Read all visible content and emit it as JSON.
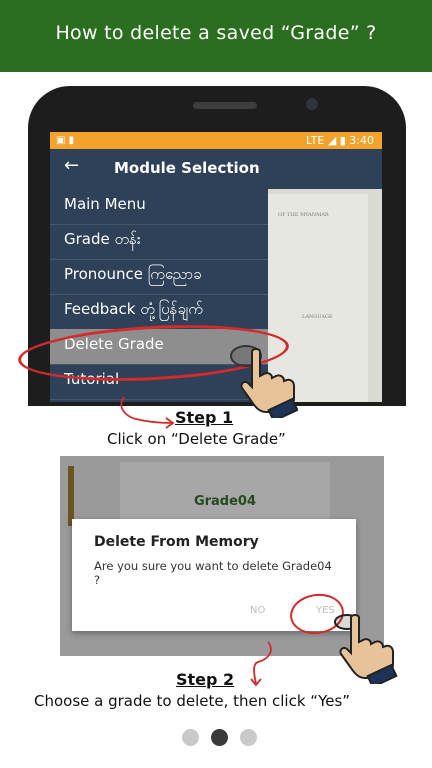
{
  "banner": {
    "title": "How to delete a saved “Grade” ?"
  },
  "phone": {
    "statusbar": {
      "left_icons": "▣ ▮",
      "right_icons": "LTE ◢ ▮",
      "time": "3:40"
    },
    "appbar": {
      "back_icon": "arrow-left-icon",
      "title": "Module Selection"
    },
    "menu": [
      {
        "label": "Main Menu"
      },
      {
        "label": "Grade တန်း"
      },
      {
        "label": "Pronounce ကြညောခ"
      },
      {
        "label": "Feedback တုံ့ပြန်ချက်"
      },
      {
        "label": "Delete Grade",
        "selected": true
      },
      {
        "label": "Tutorial"
      }
    ],
    "background_doc": {
      "line1": "OF THE MYANMAR",
      "line2": "LANGUAGE"
    }
  },
  "steps": [
    {
      "title": "Step 1",
      "desc": "Click on “Delete Grade”"
    },
    {
      "title": "Step 2",
      "desc": "Choose a grade to delete, then click “Yes”"
    }
  ],
  "screen2": {
    "card_label": "Grade04",
    "dialog": {
      "title": "Delete From Memory",
      "message": "Are you sure you want to delete Grade04 ?",
      "no_label": "NO",
      "yes_label": "YES"
    }
  },
  "pager": {
    "active_index": 1,
    "count": 3
  },
  "colors": {
    "banner": "#2c6e1f",
    "appbar": "#2e4158",
    "statusbar": "#f3a22b",
    "highlight": "#d22b2b"
  }
}
